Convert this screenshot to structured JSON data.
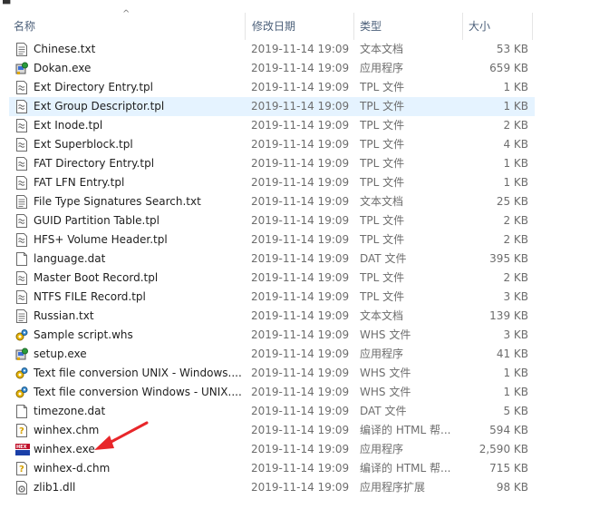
{
  "header": {
    "name": "名称",
    "date": "修改日期",
    "type": "类型",
    "size": "大小"
  },
  "files": [
    {
      "name": "Chinese.txt",
      "date": "2019-11-14 19:09",
      "type": "文本文档",
      "size": "53 KB",
      "icon": "text-file-icon"
    },
    {
      "name": "Dokan.exe",
      "date": "2019-11-14 19:09",
      "type": "应用程序",
      "size": "659 KB",
      "icon": "installer-icon"
    },
    {
      "name": "Ext Directory Entry.tpl",
      "date": "2019-11-14 19:09",
      "type": "TPL 文件",
      "size": "1 KB",
      "icon": "template-file-icon"
    },
    {
      "name": "Ext Group Descriptor.tpl",
      "date": "2019-11-14 19:09",
      "type": "TPL 文件",
      "size": "1 KB",
      "icon": "template-file-icon",
      "selected": true
    },
    {
      "name": "Ext Inode.tpl",
      "date": "2019-11-14 19:09",
      "type": "TPL 文件",
      "size": "2 KB",
      "icon": "template-file-icon"
    },
    {
      "name": "Ext Superblock.tpl",
      "date": "2019-11-14 19:09",
      "type": "TPL 文件",
      "size": "4 KB",
      "icon": "template-file-icon"
    },
    {
      "name": "FAT Directory Entry.tpl",
      "date": "2019-11-14 19:09",
      "type": "TPL 文件",
      "size": "1 KB",
      "icon": "template-file-icon"
    },
    {
      "name": "FAT LFN Entry.tpl",
      "date": "2019-11-14 19:09",
      "type": "TPL 文件",
      "size": "1 KB",
      "icon": "template-file-icon"
    },
    {
      "name": "File Type Signatures Search.txt",
      "date": "2019-11-14 19:09",
      "type": "文本文档",
      "size": "25 KB",
      "icon": "text-file-icon"
    },
    {
      "name": "GUID Partition Table.tpl",
      "date": "2019-11-14 19:09",
      "type": "TPL 文件",
      "size": "2 KB",
      "icon": "template-file-icon"
    },
    {
      "name": "HFS+ Volume Header.tpl",
      "date": "2019-11-14 19:09",
      "type": "TPL 文件",
      "size": "2 KB",
      "icon": "template-file-icon"
    },
    {
      "name": "language.dat",
      "date": "2019-11-14 19:09",
      "type": "DAT 文件",
      "size": "395 KB",
      "icon": "blank-file-icon"
    },
    {
      "name": "Master Boot Record.tpl",
      "date": "2019-11-14 19:09",
      "type": "TPL 文件",
      "size": "2 KB",
      "icon": "template-file-icon"
    },
    {
      "name": "NTFS FILE Record.tpl",
      "date": "2019-11-14 19:09",
      "type": "TPL 文件",
      "size": "3 KB",
      "icon": "template-file-icon"
    },
    {
      "name": "Russian.txt",
      "date": "2019-11-14 19:09",
      "type": "文本文档",
      "size": "139 KB",
      "icon": "text-file-icon"
    },
    {
      "name": "Sample script.whs",
      "date": "2019-11-14 19:09",
      "type": "WHS 文件",
      "size": "3 KB",
      "icon": "script-gear-icon"
    },
    {
      "name": "setup.exe",
      "date": "2019-11-14 19:09",
      "type": "应用程序",
      "size": "41 KB",
      "icon": "installer-icon"
    },
    {
      "name": "Text file conversion UNIX - Windows....",
      "date": "2019-11-14 19:09",
      "type": "WHS 文件",
      "size": "1 KB",
      "icon": "script-gear-icon"
    },
    {
      "name": "Text file conversion Windows - UNIX....",
      "date": "2019-11-14 19:09",
      "type": "WHS 文件",
      "size": "1 KB",
      "icon": "script-gear-icon"
    },
    {
      "name": "timezone.dat",
      "date": "2019-11-14 19:09",
      "type": "DAT 文件",
      "size": "5 KB",
      "icon": "blank-file-icon"
    },
    {
      "name": "winhex.chm",
      "date": "2019-11-14 19:09",
      "type": "编译的 HTML 帮...",
      "size": "594 KB",
      "icon": "help-file-icon"
    },
    {
      "name": "winhex.exe",
      "date": "2019-11-14 19:09",
      "type": "应用程序",
      "size": "2,590 KB",
      "icon": "winhex-app-icon"
    },
    {
      "name": "winhex-d.chm",
      "date": "2019-11-14 19:09",
      "type": "编译的 HTML 帮...",
      "size": "715 KB",
      "icon": "help-file-icon"
    },
    {
      "name": "zlib1.dll",
      "date": "2019-11-14 19:09",
      "type": "应用程序扩展",
      "size": "98 KB",
      "icon": "dll-file-icon"
    }
  ],
  "colors": {
    "selected_row": "#e5f3ff",
    "header_text": "#4c607a",
    "annotation_arrow": "#e8262a"
  }
}
